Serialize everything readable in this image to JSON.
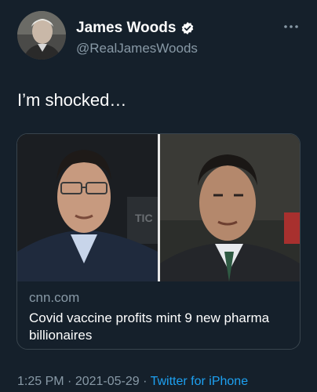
{
  "author": {
    "display_name": "James Woods",
    "handle": "@RealJamesWoods",
    "verified": true
  },
  "tweet": {
    "text": "I’m shocked…"
  },
  "card": {
    "domain": "cnn.com",
    "title": "Covid vaccine profits mint 9 new pharma billionaires"
  },
  "meta": {
    "time": "1:25 PM",
    "separator1": " · ",
    "date": "2021-05-29",
    "separator2": " · ",
    "source": "Twitter for iPhone"
  },
  "icons": {
    "verified": "verified-badge-icon",
    "more": "more-options-icon"
  },
  "colors": {
    "background": "#15202b",
    "secondary_text": "#8899a6",
    "accent": "#1da1f2",
    "border": "#38444d"
  }
}
